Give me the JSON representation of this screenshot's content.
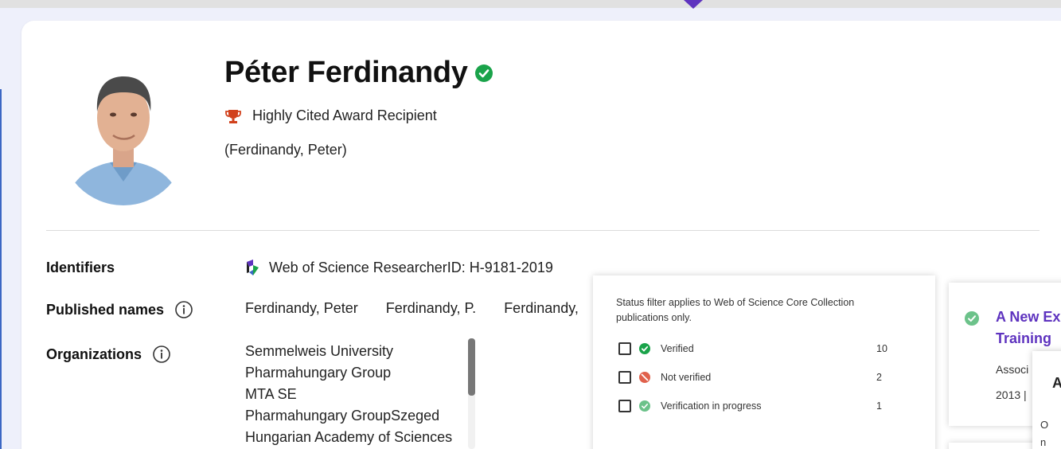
{
  "profile": {
    "name": "Péter Ferdinandy",
    "award": "Highly Cited Award Recipient",
    "alias": "(Ferdinandy, Peter)"
  },
  "details": {
    "identifiers_label": "Identifiers",
    "researcher_id": "Web of Science ResearcherID: H-9181-2019",
    "published_names_label": "Published names",
    "published_names": [
      "Ferdinandy, Peter",
      "Ferdinandy, P.",
      "Ferdinandy,"
    ],
    "organizations_label": "Organizations",
    "organizations": [
      "Semmelweis University",
      "Pharmahungary Group",
      "MTA SE",
      "Pharmahungary GroupSzeged",
      "Hungarian Academy of Sciences"
    ]
  },
  "status_filter": {
    "note": "Status filter applies to Web of Science Core Collection publications only.",
    "items": [
      {
        "label": "Verified",
        "count": "10"
      },
      {
        "label": "Not verified",
        "count": "2"
      },
      {
        "label": "Verification in progress",
        "count": "1"
      }
    ]
  },
  "result_card": {
    "title_line1": "A New Ex",
    "title_line2": "Training",
    "meta_line1": "Associ",
    "meta_line2": "2013 |"
  },
  "popup": {
    "letter": "A",
    "text_line1": "O",
    "text_line2": "n"
  },
  "colors": {
    "accent": "#5e33bf",
    "verified": "#1aa34a",
    "award": "#d1411c",
    "not_verified": "#e0614c"
  },
  "icons": {
    "verified": "verified-check-icon",
    "award": "trophy-icon",
    "info": "info-icon",
    "wos": "web-of-science-logo-icon"
  }
}
